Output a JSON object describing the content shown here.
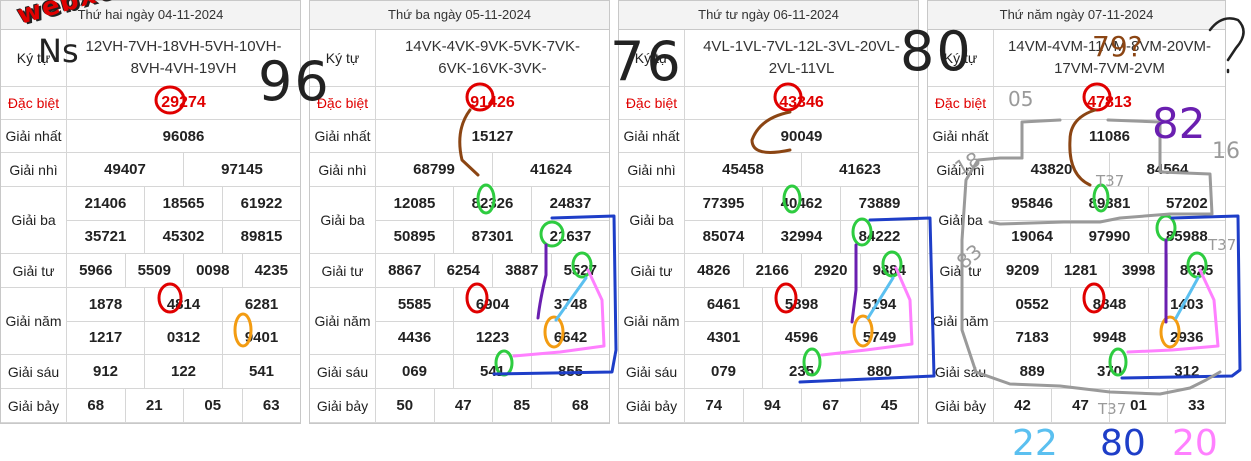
{
  "site": {
    "logo": "webxoso.net"
  },
  "labels": {
    "ky_tu": "Ký tự",
    "dac_biet": "Đặc biệt",
    "giai_nhat": "Giải nhất",
    "giai_nhi": "Giải nhì",
    "giai_ba": "Giải ba",
    "giai_tu": "Giải tư",
    "giai_nam": "Giải năm",
    "giai_sau": "Giải sáu",
    "giai_bay": "Giải bảy"
  },
  "panels": [
    {
      "title": "Thứ hai ngày 04-11-2024",
      "kytu": [
        "12VH-7VH-18VH-5VH-10VH-",
        "8VH-4VH-19VH"
      ],
      "dac_biet": "29274",
      "giai_nhat": "96086",
      "giai_nhi": [
        "49407",
        "97145"
      ],
      "giai_ba": [
        [
          "21406",
          "18565",
          "61922"
        ],
        [
          "35721",
          "45302",
          "89815"
        ]
      ],
      "giai_tu": [
        "5966",
        "5509",
        "0098",
        "4235"
      ],
      "giai_nam": [
        [
          "1878",
          "4814",
          "6281"
        ],
        [
          "1217",
          "0312",
          "9401"
        ]
      ],
      "giai_sau": [
        "912",
        "122",
        "541"
      ],
      "giai_bay": [
        "68",
        "21",
        "05",
        "63"
      ]
    },
    {
      "title": "Thứ ba ngày 05-11-2024",
      "kytu": [
        "14VK-4VK-9VK-5VK-7VK-",
        "6VK-16VK-3VK-"
      ],
      "dac_biet": "91426",
      "giai_nhat": "15127",
      "giai_nhi": [
        "68799",
        "41624"
      ],
      "giai_ba": [
        [
          "12085",
          "82326",
          "24837"
        ],
        [
          "50895",
          "87301",
          "21637"
        ]
      ],
      "giai_tu": [
        "8867",
        "6254",
        "3887",
        "5527"
      ],
      "giai_nam": [
        [
          "5585",
          "6904",
          "3748"
        ],
        [
          "4436",
          "1223",
          "6642"
        ]
      ],
      "giai_sau": [
        "069",
        "541",
        "855"
      ],
      "giai_bay": [
        "50",
        "47",
        "85",
        "68"
      ]
    },
    {
      "title": "Thứ tư ngày 06-11-2024",
      "kytu": [
        "4VL-1VL-7VL-12L-3VL-20VL-",
        "2VL-11VL"
      ],
      "dac_biet": "43346",
      "giai_nhat": "90049",
      "giai_nhi": [
        "45458",
        "41623"
      ],
      "giai_ba": [
        [
          "77395",
          "40462",
          "73889"
        ],
        [
          "85074",
          "32994",
          "84222"
        ]
      ],
      "giai_tu": [
        "4826",
        "2166",
        "2920",
        "9884"
      ],
      "giai_nam": [
        [
          "6461",
          "5898",
          "5194"
        ],
        [
          "4301",
          "4596",
          "5749"
        ]
      ],
      "giai_sau": [
        "079",
        "235",
        "880"
      ],
      "giai_bay": [
        "74",
        "94",
        "67",
        "45"
      ]
    },
    {
      "title": "Thứ năm ngày 07-11-2024",
      "kytu": [
        "14VM-4VM-11VM-8VM-20VM-",
        "17VM-7VM-2VM"
      ],
      "dac_biet": "47813",
      "giai_nhat": "11086",
      "giai_nhi": [
        "43820",
        "84564"
      ],
      "giai_ba": [
        [
          "95846",
          "89381",
          "57202"
        ],
        [
          "19064",
          "97990",
          "85988"
        ]
      ],
      "giai_tu": [
        "9209",
        "1281",
        "3998",
        "8325"
      ],
      "giai_nam": [
        [
          "0552",
          "8848",
          "1403"
        ],
        [
          "7183",
          "9948",
          "2936"
        ]
      ],
      "giai_sau": [
        "889",
        "370",
        "312"
      ],
      "giai_bay": [
        "42",
        "47",
        "01",
        "33"
      ]
    }
  ],
  "annotations": {
    "big_numbers": [
      "96",
      "76",
      "80"
    ],
    "ns": "Ns",
    "q79": "79?",
    "n05": "05",
    "n82": "82",
    "n16": "16",
    "n18": "18",
    "n83": "83",
    "t37a": "T37",
    "t37b": "T37",
    "t37c": "T37",
    "bottom": [
      "22",
      "80",
      "20"
    ],
    "colors": {
      "red": "#e00000",
      "brown": "#8b4513",
      "green": "#2ecc40",
      "blue": "#1e3ec8",
      "purple": "#6a1fb0",
      "orange": "#f39c12",
      "pink": "#ff80ff",
      "cyan": "#5bc0f0",
      "gray": "#9a9a9a",
      "black": "#222222"
    }
  }
}
